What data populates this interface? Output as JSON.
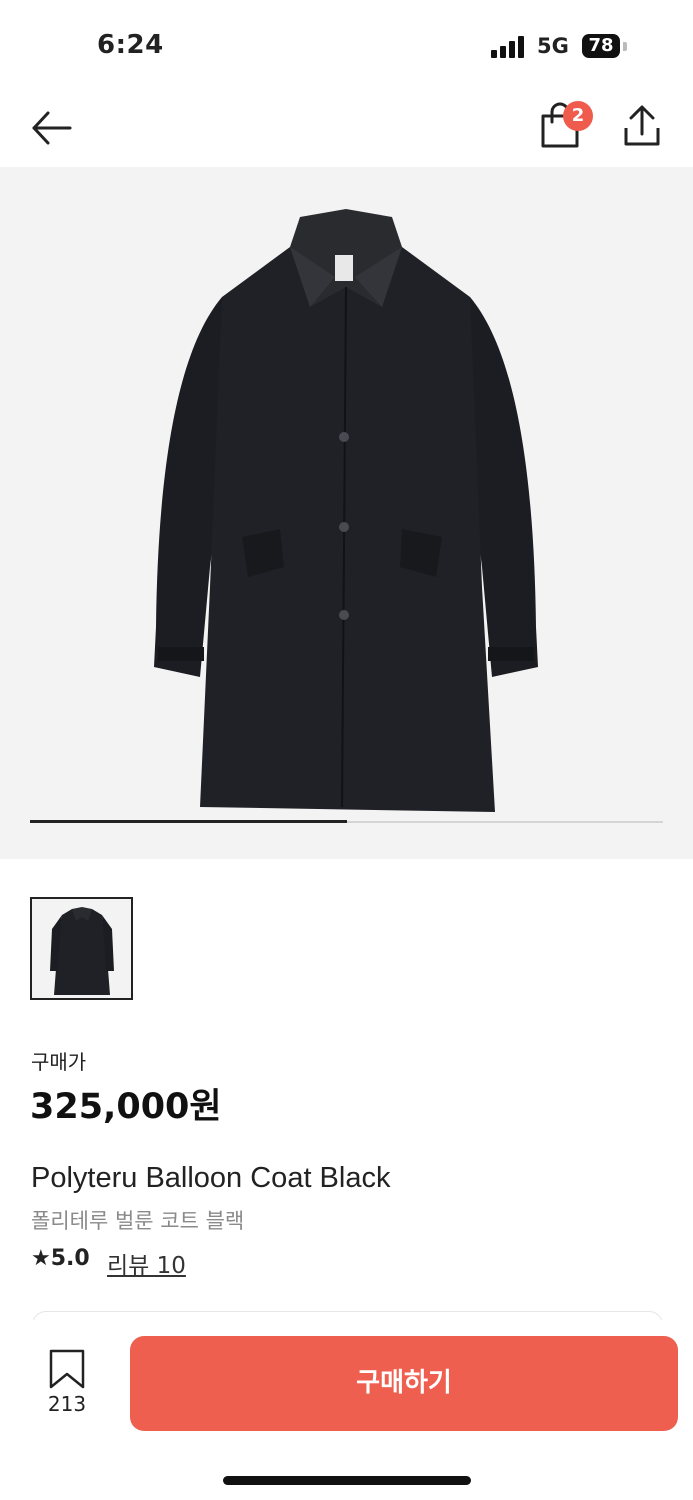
{
  "status_bar": {
    "time": "6:24",
    "network": "5G",
    "battery": "78"
  },
  "header": {
    "cart_count": "2"
  },
  "product": {
    "image_progress": 0.5,
    "price_label": "구매가",
    "price": "325,000원",
    "name_en": "Polyteru Balloon Coat Black",
    "name_ko": "폴리테루 벌룬 코트 블랙",
    "rating_star": "★",
    "rating": "5.0",
    "review_link": "리뷰 10"
  },
  "bottom_bar": {
    "bookmark_count": "213",
    "buy_label": "구매하기"
  },
  "colors": {
    "accent": "#ef5f50",
    "badge": "#ef5b4c"
  },
  "icons": [
    "back-arrow-icon",
    "shopping-bag-icon",
    "share-icon",
    "bookmark-icon",
    "star-icon"
  ]
}
